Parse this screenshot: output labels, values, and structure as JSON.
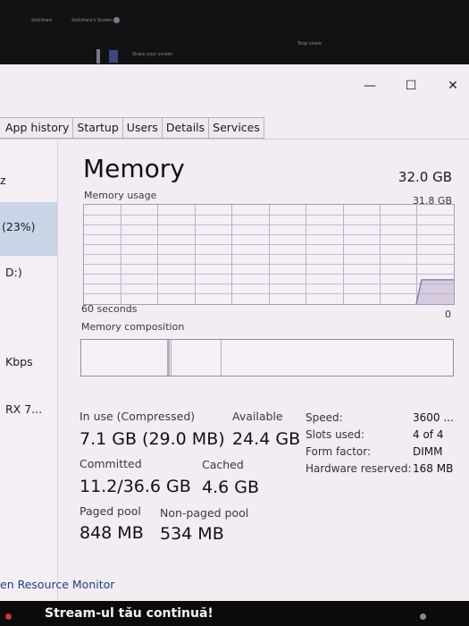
{
  "taskbar": {
    "items": [
      "Solicitare",
      "Solicitare's Screen",
      "Share your screen",
      "Stop share"
    ]
  },
  "window": {
    "controls": {
      "minimize": "—",
      "maximize": "☐",
      "close": "✕"
    }
  },
  "tabs": [
    "App history",
    "Startup",
    "Users",
    "Details",
    "Services"
  ],
  "sidebar": {
    "items": [
      {
        "label": "z",
        "selected": false
      },
      {
        "label": "(23%)",
        "selected": true
      },
      {
        "label": "D:)",
        "selected": false
      },
      {
        "label": "Kbps",
        "selected": false
      },
      {
        "label": "RX 7...",
        "selected": false
      }
    ]
  },
  "memory": {
    "title": "Memory",
    "total": "32.0 GB",
    "usage_label": "Memory usage",
    "usage_max": "31.8 GB",
    "axis_left": "60 seconds",
    "axis_right": "0",
    "composition_label": "Memory composition",
    "stats": {
      "in_use_label": "In use (Compressed)",
      "in_use_value": "7.1 GB (29.0 MB)",
      "available_label": "Available",
      "available_value": "24.4 GB",
      "committed_label": "Committed",
      "committed_value": "11.2/36.6 GB",
      "cached_label": "Cached",
      "cached_value": "4.6 GB",
      "paged_pool_label": "Paged pool",
      "paged_pool_value": "848 MB",
      "nonpaged_pool_label": "Non-paged pool",
      "nonpaged_pool_value": "534 MB"
    },
    "info": [
      {
        "label": "Speed:",
        "value": "3600 ..."
      },
      {
        "label": "Slots used:",
        "value": "4 of 4"
      },
      {
        "label": "Form factor:",
        "value": "DIMM"
      },
      {
        "label": "Hardware reserved:",
        "value": "168 MB"
      }
    ]
  },
  "footer_link": "en Resource Monitor",
  "overlay_text": "Stream-ul tău continuă!",
  "colors": {
    "window_bg": "#f3edf3",
    "graph_border": "#9aa2b8",
    "selected_bg": "#c9d4e6",
    "link": "#1a3f8f"
  }
}
